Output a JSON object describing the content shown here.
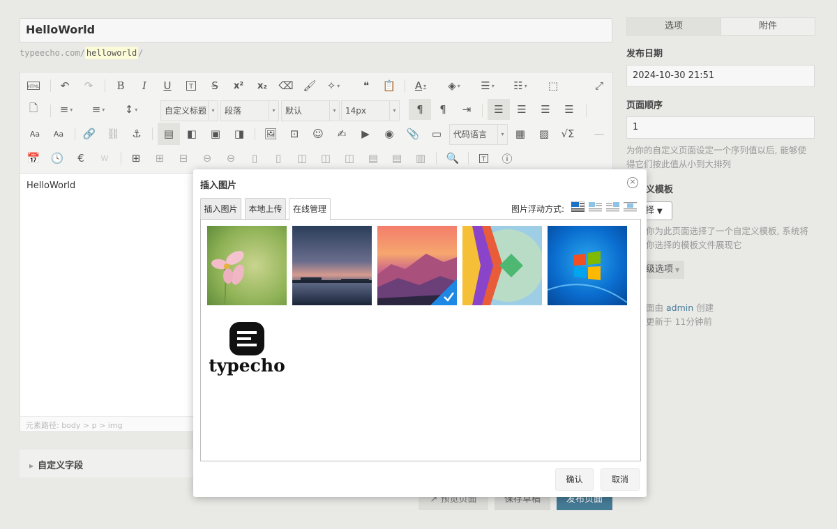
{
  "post": {
    "title": "HelloWorld",
    "slug_prefix": "typeecho.com/",
    "slug": "helloworld",
    "slug_suffix": "/"
  },
  "toolbar": {
    "heading_select": "自定义标题",
    "paragraph_select": "段落",
    "font_select": "默认",
    "size_select": "14px",
    "code_select": "代码语言"
  },
  "editor": {
    "content": "HelloWorld",
    "path": "元素路径: body > p > img"
  },
  "custom_fields": {
    "label": "自定义字段"
  },
  "bottom_buttons": {
    "preview": "预览页面",
    "save": "保存草稿",
    "publish": "发布页面"
  },
  "sidebar": {
    "tabs": [
      "选项",
      "附件"
    ],
    "date_label": "发布日期",
    "date_value": "2024-10-30 21:51",
    "order_label": "页面顺序",
    "order_value": "1",
    "order_desc_1": "为你的自定义页面设定一个序列值以后, 能够使",
    "order_desc_2": "得它们按此值从小到大排列",
    "template_label": "义模板",
    "template_select": "择",
    "template_desc_1": "你为此页面选择了一个自定义模板, 系统将",
    "template_desc_2": "你选择的模板文件展现它",
    "advanced_label": "级选项",
    "created_pre": "面由",
    "created_user": "admin",
    "created_post": "创建",
    "updated": "更新于 11分钟前"
  },
  "dialog": {
    "title": "插入图片",
    "tabs": [
      "插入图片",
      "本地上传",
      "在线管理"
    ],
    "float_label": "图片浮动方式:",
    "typecho_logo_text": "typecho",
    "confirm": "确认",
    "cancel": "取消"
  },
  "colors": {
    "accent": "#467b96",
    "background": "#e9e9e6"
  }
}
